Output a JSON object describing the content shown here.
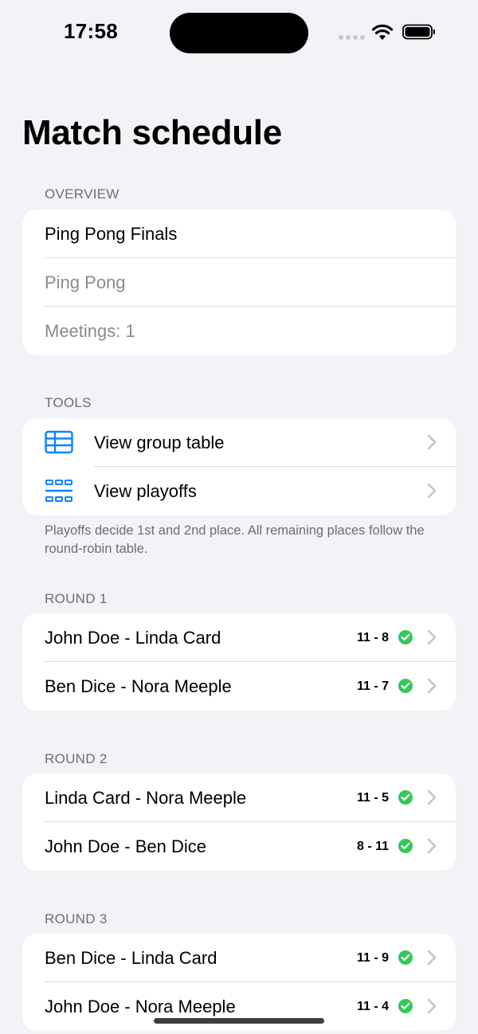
{
  "status_bar": {
    "time": "17:58"
  },
  "page_title": "Match schedule",
  "overview": {
    "header": "OVERVIEW",
    "rows": [
      "Ping Pong Finals",
      "Ping Pong",
      "Meetings: 1"
    ]
  },
  "tools": {
    "header": "TOOLS",
    "items": [
      {
        "label": "View group table",
        "icon": "table-icon"
      },
      {
        "label": "View playoffs",
        "icon": "bracket-grid-icon"
      }
    ],
    "footnote": "Playoffs decide 1st and 2nd place. All remaining places follow the round-robin table."
  },
  "rounds": [
    {
      "header": "ROUND 1",
      "matches": [
        {
          "label": "John Doe - Linda Card",
          "score": "11 - 8"
        },
        {
          "label": "Ben Dice - Nora Meeple",
          "score": "11 - 7"
        }
      ]
    },
    {
      "header": "ROUND 2",
      "matches": [
        {
          "label": "Linda Card - Nora Meeple",
          "score": "11 - 5"
        },
        {
          "label": "John Doe - Ben Dice",
          "score": "8 - 11"
        }
      ]
    },
    {
      "header": "ROUND 3",
      "matches": [
        {
          "label": "Ben Dice - Linda Card",
          "score": "11 - 9"
        },
        {
          "label": "John Doe - Nora Meeple",
          "score": "11 - 4"
        }
      ]
    }
  ],
  "colors": {
    "accent": "#0a84ff",
    "success": "#34c759",
    "background": "#f2f2f7"
  }
}
